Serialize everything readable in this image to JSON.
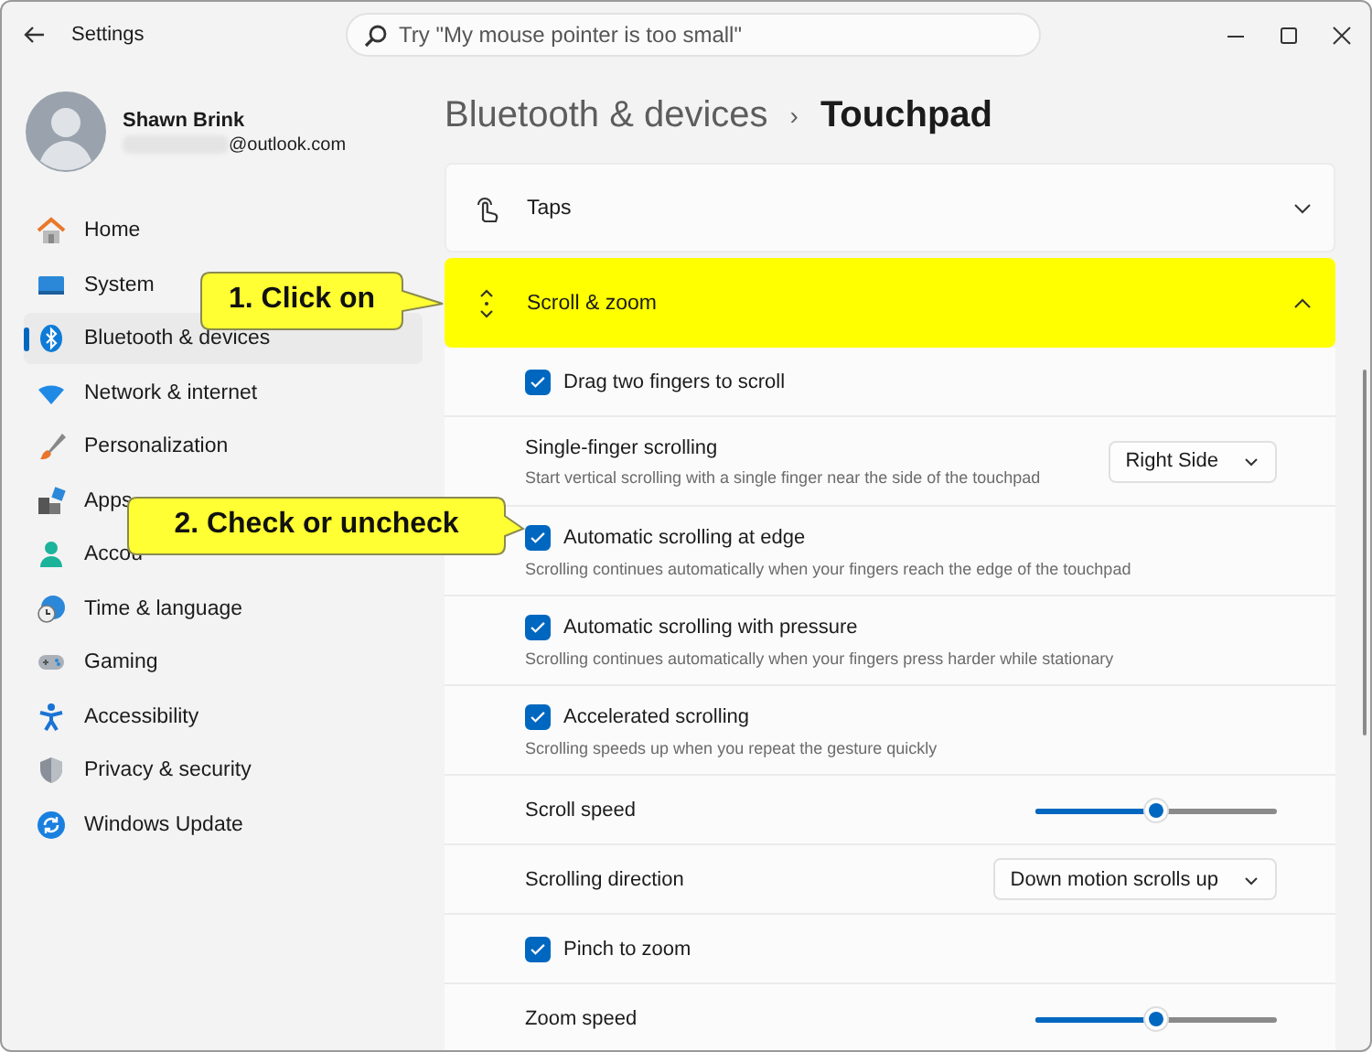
{
  "window": {
    "title": "Settings"
  },
  "search": {
    "placeholder": "Try \"My mouse pointer is too small\""
  },
  "user": {
    "name": "Shawn Brink",
    "email": "@outlook.com"
  },
  "sidebar": {
    "items": [
      {
        "label": "Home",
        "selected": false
      },
      {
        "label": "System",
        "selected": false
      },
      {
        "label": "Bluetooth & devices",
        "selected": true
      },
      {
        "label": "Network & internet",
        "selected": false
      },
      {
        "label": "Personalization",
        "selected": false
      },
      {
        "label": "Apps",
        "selected": false
      },
      {
        "label": "Accou",
        "selected": false
      },
      {
        "label": "Time & language",
        "selected": false
      },
      {
        "label": "Gaming",
        "selected": false
      },
      {
        "label": "Accessibility",
        "selected": false
      },
      {
        "label": "Privacy & security",
        "selected": false
      },
      {
        "label": "Windows Update",
        "selected": false
      }
    ]
  },
  "breadcrumb": {
    "parent": "Bluetooth & devices",
    "separator": "›",
    "current": "Touchpad"
  },
  "sections": [
    {
      "title": "Taps",
      "expanded": false,
      "highlighted": false
    },
    {
      "title": "Scroll & zoom",
      "expanded": true,
      "highlighted": true,
      "rows": [
        {
          "kind": "checkbox",
          "label": "Drag two fingers to scroll",
          "checked": true
        },
        {
          "kind": "dropdown",
          "label": "Single-finger scrolling",
          "description": "Start vertical scrolling with a single finger near the side of the touchpad",
          "value": "Right Side"
        },
        {
          "kind": "checkbox",
          "label": "Automatic scrolling at edge",
          "description": "Scrolling continues automatically when your fingers reach the edge of the touchpad",
          "checked": true
        },
        {
          "kind": "checkbox",
          "label": "Automatic scrolling with pressure",
          "description": "Scrolling continues automatically when your fingers press harder while stationary",
          "checked": true
        },
        {
          "kind": "checkbox",
          "label": "Accelerated scrolling",
          "description": "Scrolling speeds up when you repeat the gesture quickly",
          "checked": true
        },
        {
          "kind": "slider",
          "label": "Scroll speed",
          "level": 0.5
        },
        {
          "kind": "dropdown",
          "label": "Scrolling direction",
          "value": "Down motion scrolls up"
        },
        {
          "kind": "checkbox",
          "label": "Pinch to zoom",
          "checked": true
        },
        {
          "kind": "slider",
          "label": "Zoom speed",
          "level": 0.5
        }
      ]
    }
  ],
  "callouts": [
    {
      "text": "1. Click on"
    },
    {
      "text": "2. Check or uncheck"
    }
  ]
}
